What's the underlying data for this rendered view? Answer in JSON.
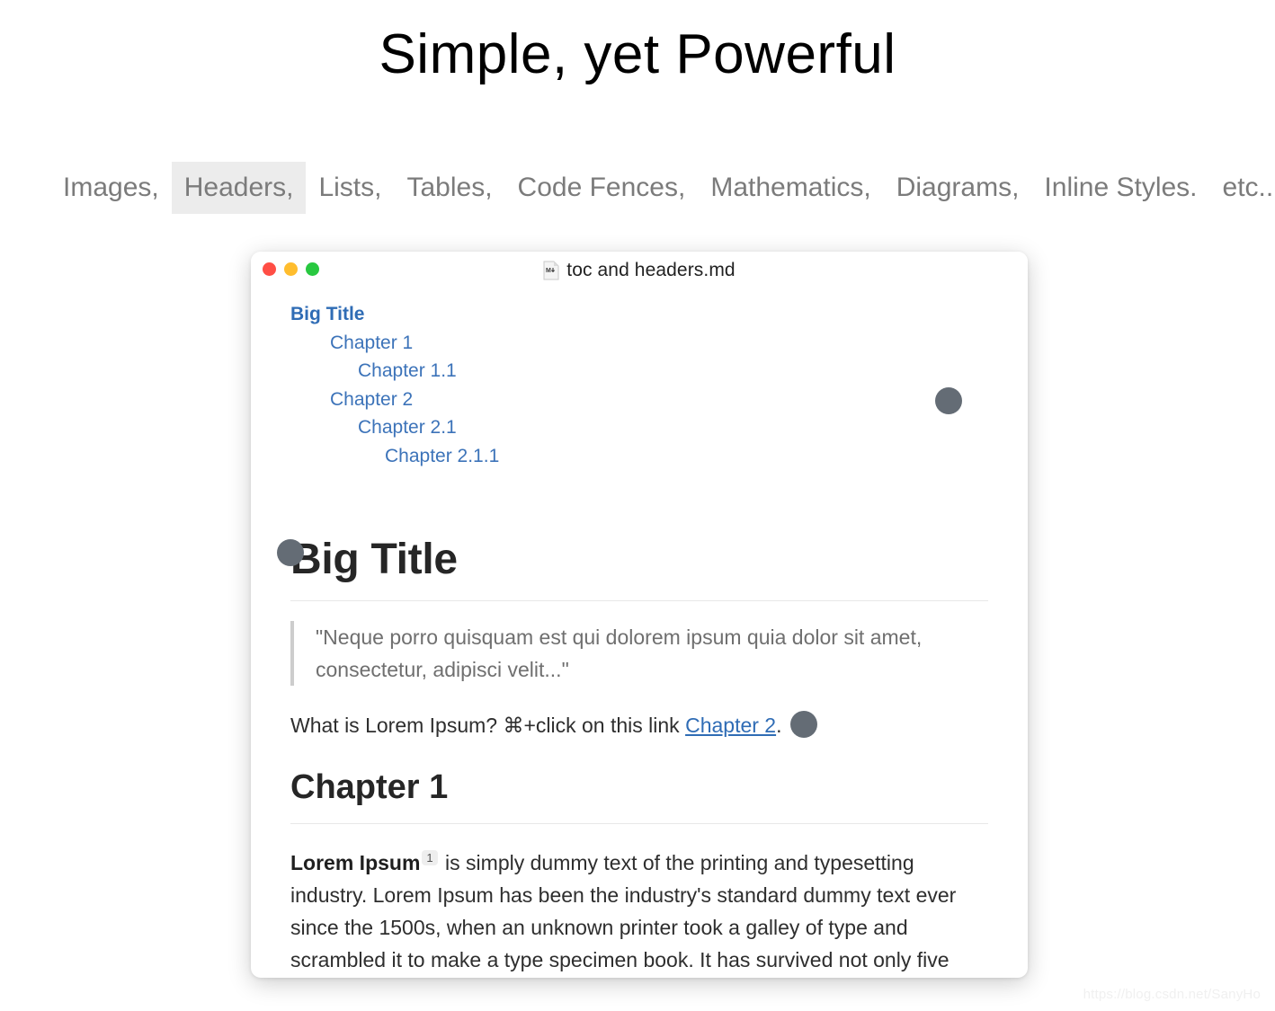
{
  "page": {
    "title": "Simple, yet Powerful",
    "watermark": "https://blog.csdn.net/SanyHo"
  },
  "feature_nav": {
    "items": [
      {
        "label": "Images,",
        "active": false
      },
      {
        "label": "Headers,",
        "active": true
      },
      {
        "label": "Lists,",
        "active": false
      },
      {
        "label": "Tables,",
        "active": false
      },
      {
        "label": "Code Fences,",
        "active": false
      },
      {
        "label": "Mathematics,",
        "active": false
      },
      {
        "label": "Diagrams,",
        "active": false
      },
      {
        "label": "Inline Styles.",
        "active": false
      },
      {
        "label": "etc..",
        "active": false
      }
    ],
    "highlight_color": "#ececec"
  },
  "window": {
    "titlebar": {
      "filename": "toc and headers.md",
      "file_icon": "markdown-document-icon",
      "traffic_lights": [
        {
          "name": "close",
          "color": "#ff4e45"
        },
        {
          "name": "minimize",
          "color": "#ffbd2e"
        },
        {
          "name": "maximize",
          "color": "#28c840"
        }
      ]
    },
    "document": {
      "toc": [
        {
          "label": "Big Title",
          "level": 0
        },
        {
          "label": "Chapter 1",
          "level": 1
        },
        {
          "label": "Chapter 1.1",
          "level": 2
        },
        {
          "label": "Chapter 2",
          "level": 1
        },
        {
          "label": "Chapter 2.1",
          "level": 2
        },
        {
          "label": "Chapter 2.1.1",
          "level": 3
        }
      ],
      "heading1": "Big Title",
      "blockquote": "\"Neque porro quisquam est qui dolorem ipsum quia dolor sit amet, consectetur, adipisci velit...\"",
      "link_paragraph": {
        "before": "What is Lorem Ipsum? ⌘+click on this link ",
        "link": "Chapter 2",
        "after": "."
      },
      "heading2": "Chapter 1",
      "body_paragraph": {
        "bold_lead": "Lorem Ipsum",
        "footnote": "1",
        "rest": " is simply dummy text of the printing and typesetting industry. Lorem Ipsum has been the industry's standard dummy text ever since the 1500s, when an unknown printer took a galley of type and scrambled it to make a type specimen book. It has survived not only five"
      },
      "link_color": "#2f6cb5",
      "toc_color": "#3c73b9"
    }
  },
  "cursors": [
    {
      "name": "cursor-dot-top-right",
      "color": "#646c75"
    },
    {
      "name": "cursor-dot-heading",
      "color": "#646c75"
    },
    {
      "name": "cursor-dot-link",
      "color": "#646c75"
    }
  ]
}
